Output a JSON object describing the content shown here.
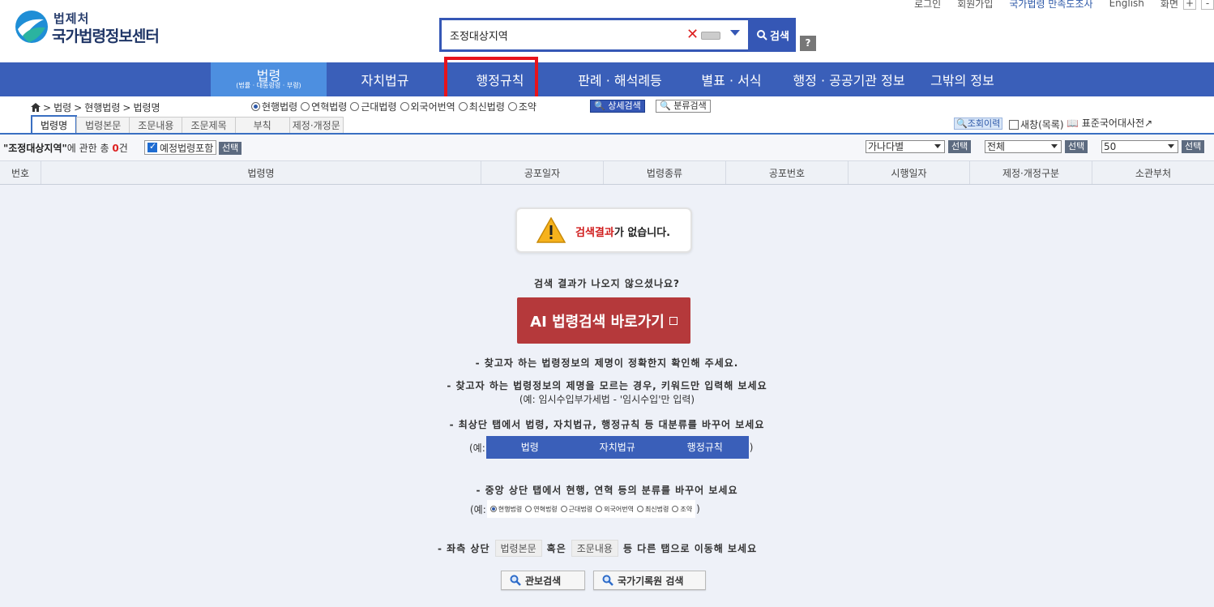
{
  "header": {
    "logo_sub": "법제처",
    "logo_main": "국가법령정보센터",
    "top_links": [
      "로그인",
      "회원가입",
      "국가법령 만족도조사",
      "English",
      "화면"
    ],
    "zoom_plus": "+",
    "zoom_minus": "-"
  },
  "search": {
    "value": "조정대상지역",
    "clear": "✕",
    "button_label": "검색",
    "help": "?"
  },
  "nav": {
    "items": [
      {
        "label": "법령",
        "sub": "(법률 · 대통령령 · 부령)"
      },
      {
        "label": "자치법규"
      },
      {
        "label": "행정규칙"
      },
      {
        "label": "판례 · 해석례등"
      },
      {
        "label": "별표 · 서식"
      },
      {
        "label": "행정 · 공공기관 정보"
      },
      {
        "label": "그밖의 정보"
      }
    ]
  },
  "breadcrumb": {
    "items": [
      "법령",
      "현행법령",
      "법령명"
    ],
    "sep": ">"
  },
  "radios": [
    "현행법령",
    "연혁법령",
    "근대법령",
    "외국어번역",
    "최신법령",
    "조약"
  ],
  "detail_search": "상세검색",
  "class_search": "분류검색",
  "tabs": [
    "법령명",
    "법령본문",
    "조문내용",
    "조문제목",
    "부칙",
    "제정·개정문"
  ],
  "side": {
    "history": "조회이력",
    "new_window": "새창(목록)",
    "dict": "표준국어대사전"
  },
  "result": {
    "query": "\"조정대상지역\"",
    "mid": "에 관한  총 ",
    "count": "0",
    "unit": "건",
    "include": "예정법령포함",
    "select": "선택",
    "sort_value": "가나다별",
    "scope_value": "전체",
    "per_page_value": "50"
  },
  "table_headers": [
    "번호",
    "법령명",
    "공포일자",
    "법령종류",
    "공포번호",
    "시행일자",
    "제정·개정구분",
    "소관부처"
  ],
  "empty": {
    "msg_red": "검색결과",
    "msg_rest": "가 없습니다.",
    "question": "검색 결과가 나오지 않으셨나요?",
    "ai_button": "AI 법령검색 바로가기",
    "tip1": "- 찾고자 하는 법령정보의 제명이 정확한지 확인해 주세요.",
    "tip2": "- 찾고자 하는 법령정보의 제명을 모르는 경우, 키워드만 입력해 보세요",
    "tip2_ex": "(예: 임시수입부가세법 - '임시수입'만 입력)",
    "tip3": "- 최상단 탭에서 법령, 자치법규, 행정규칙 등 대분류를 바꾸어 보세요",
    "ex_open": "(예:",
    "ex_close": ")",
    "ex_nav": [
      "법령",
      "자치법규",
      "행정규칙"
    ],
    "tip4": "- 중앙 상단 탭에서 현행, 연혁 등의 분류를 바꾸어 보세요",
    "tip5_a": "- 좌측 상단",
    "tip5_tab1": "법령본문",
    "tip5_b": "혹은",
    "tip5_tab2": "조문내용",
    "tip5_c": "등 다른 탭으로 이동해 보세요",
    "btn_gazette": "관보검색",
    "btn_archive": "국가기록원 검색"
  }
}
